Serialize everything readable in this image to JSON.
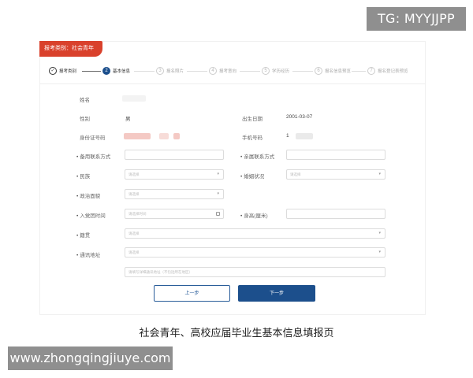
{
  "watermarks": {
    "top_right": "TG: MYYJJPP",
    "bottom_left": "www.zhongqingjiuye.com"
  },
  "category_tag": "报考类别：社会青年",
  "steps": [
    {
      "num": "✓",
      "label": "报考类别",
      "state": "done"
    },
    {
      "num": "2",
      "label": "基本信息",
      "state": "active"
    },
    {
      "num": "3",
      "label": "报名照片",
      "state": "pending"
    },
    {
      "num": "4",
      "label": "报考意向",
      "state": "pending"
    },
    {
      "num": "5",
      "label": "学历经历",
      "state": "pending"
    },
    {
      "num": "6",
      "label": "报名信息预览",
      "state": "pending"
    },
    {
      "num": "7",
      "label": "报名登记表预览",
      "state": "pending"
    }
  ],
  "form": {
    "name_label": "姓名",
    "gender_label": "性别",
    "gender_value": "男",
    "birth_label": "出生日期",
    "birth_value": "2001-03-07",
    "id_label": "身份证号码",
    "phone_label": "手机号码",
    "phone_prefix": "1",
    "backup_contact_label": "备用联系方式",
    "family_contact_label": "亲属联系方式",
    "ethnicity_label": "民族",
    "ethnicity_placeholder": "请选择",
    "marital_label": "婚姻状况",
    "marital_placeholder": "请选择",
    "political_label": "政治面貌",
    "political_placeholder": "请选择",
    "join_time_label": "入党团时间",
    "join_time_placeholder": "请选择时间",
    "height_label": "身高(厘米)",
    "native_label": "籍贯",
    "native_placeholder": "请选择",
    "address_label": "通讯地址",
    "address_placeholder": "请选择",
    "address_detail_placeholder": "请填写详细通讯地址（不包括所在地区）",
    "prev_button": "上一步",
    "next_button": "下一步"
  },
  "caption": "社会青年、高校应届毕业生基本信息填报页",
  "colors": {
    "brand_red": "#d9412c",
    "primary_blue": "#1c4f8c"
  }
}
